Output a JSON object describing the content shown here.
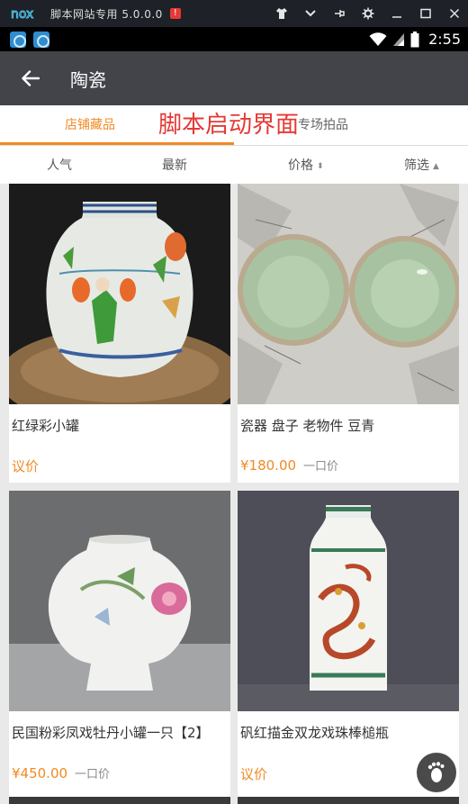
{
  "emulator": {
    "logo": "nox",
    "title": "脚本网站专用 5.0.0.0",
    "badge": "!",
    "icons": [
      "shirt-icon",
      "chevron-down-icon",
      "pin-icon",
      "gear-icon",
      "minimize-icon",
      "maximize-icon",
      "close-icon"
    ]
  },
  "status_bar": {
    "time": "2:55",
    "icons": [
      "wifi-icon",
      "signal-icon",
      "battery-icon"
    ]
  },
  "toolbar": {
    "title": "陶瓷",
    "back_icon": "arrow-left-icon"
  },
  "tabs": [
    {
      "label": "店铺藏品",
      "active": true
    },
    {
      "label": "专场拍品",
      "active": false
    }
  ],
  "overlay_title": "脚本启动界面",
  "sort": [
    {
      "label": "人气"
    },
    {
      "label": "最新"
    },
    {
      "label": "价格",
      "indicator": "sort-both-icon"
    },
    {
      "label": "筛选",
      "indicator": "triangle-up-icon"
    }
  ],
  "products": [
    {
      "title": "红绿彩小罐",
      "price": "议价",
      "price_type": ""
    },
    {
      "title": "瓷器 盘子 老物件 豆青",
      "price": "¥180.00",
      "price_type": "一口价"
    },
    {
      "title": "民国粉彩凤戏牡丹小罐一只【2】",
      "price": "¥450.00",
      "price_type": "一口价"
    },
    {
      "title": "矾红描金双龙戏珠棒槌瓶",
      "price": "议价",
      "price_type": ""
    }
  ],
  "colors": {
    "accent": "#f08a24",
    "toolbar": "#43444a",
    "overlay": "#e53935"
  },
  "float_button_icon": "footprint-icon"
}
